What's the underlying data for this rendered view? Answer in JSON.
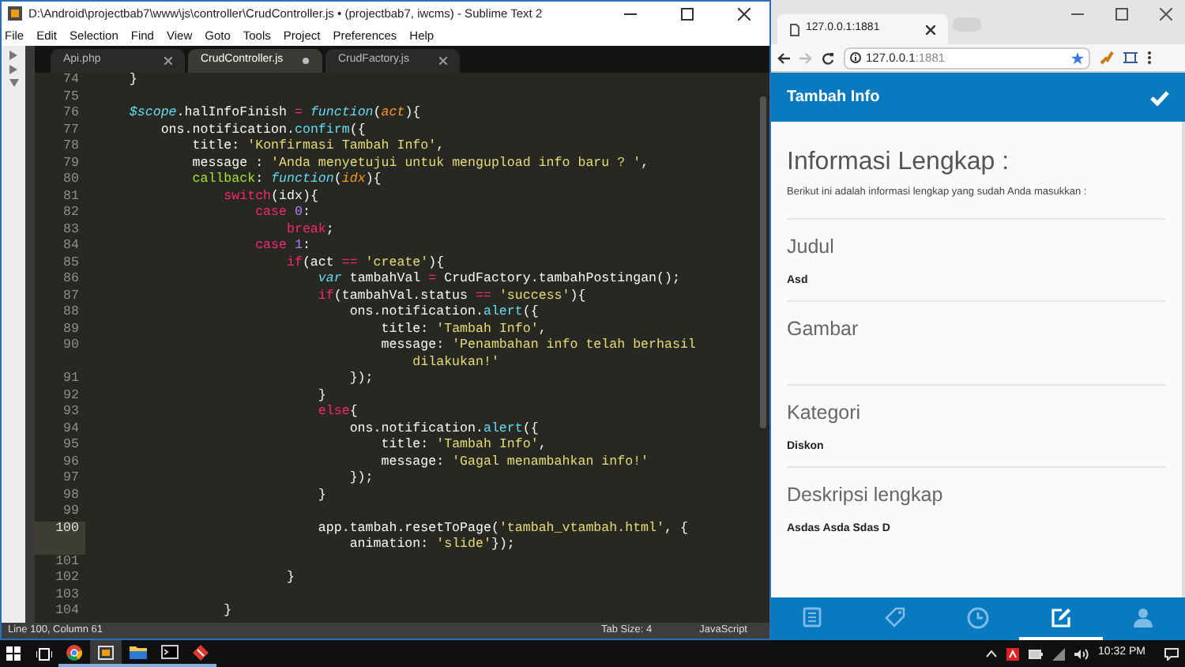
{
  "editor_window": {
    "title": "D:\\Android\\projectbab7\\www\\js\\controller\\CrudController.js • (projectbab7, iwcms) - Sublime Text 2",
    "menu": [
      "File",
      "Edit",
      "Selection",
      "Find",
      "View",
      "Goto",
      "Tools",
      "Project",
      "Preferences",
      "Help"
    ],
    "tabs": [
      {
        "label": "Api.php",
        "selected": false,
        "modified": false
      },
      {
        "label": "CrudController.js",
        "selected": true,
        "modified": true
      },
      {
        "label": "CrudFactory.js",
        "selected": false,
        "modified": false
      }
    ],
    "code_lines": [
      {
        "number": "74",
        "current": false,
        "rows": [
          {
            "segments": [
              {
                "text": "    }",
                "kind": "plain"
              }
            ]
          }
        ]
      },
      {
        "number": "75",
        "current": false,
        "rows": [
          {
            "segments": []
          }
        ]
      },
      {
        "number": "76",
        "current": false,
        "rows": [
          {
            "segments": [
              {
                "text": "    $scope",
                "kind": "storage"
              },
              {
                "text": ".halInfoFinish ",
                "kind": "plain"
              },
              {
                "text": "=",
                "kind": "keyword"
              },
              {
                "text": " function",
                "kind": "storage"
              },
              {
                "text": "(",
                "kind": "plain"
              },
              {
                "text": "act",
                "kind": "param"
              },
              {
                "text": "){",
                "kind": "plain"
              }
            ]
          }
        ]
      },
      {
        "number": "77",
        "current": false,
        "rows": [
          {
            "segments": [
              {
                "text": "        ons.notification.",
                "kind": "plain"
              },
              {
                "text": "confirm",
                "kind": "method"
              },
              {
                "text": "({",
                "kind": "plain"
              }
            ]
          }
        ]
      },
      {
        "number": "78",
        "current": false,
        "rows": [
          {
            "segments": [
              {
                "text": "            title: ",
                "kind": "plain"
              },
              {
                "text": "'Konfirmasi Tambah Info'",
                "kind": "string"
              },
              {
                "text": ",",
                "kind": "plain"
              }
            ]
          }
        ]
      },
      {
        "number": "79",
        "current": false,
        "rows": [
          {
            "segments": [
              {
                "text": "            message : ",
                "kind": "plain"
              },
              {
                "text": "'Anda menyetujui untuk mengupload info baru ? '",
                "kind": "string"
              },
              {
                "text": ",",
                "kind": "plain"
              }
            ]
          }
        ]
      },
      {
        "number": "80",
        "current": false,
        "rows": [
          {
            "segments": [
              {
                "text": "            callback",
                "kind": "entity"
              },
              {
                "text": ": ",
                "kind": "plain"
              },
              {
                "text": "function",
                "kind": "storage"
              },
              {
                "text": "(",
                "kind": "plain"
              },
              {
                "text": "idx",
                "kind": "param"
              },
              {
                "text": "){",
                "kind": "plain"
              }
            ]
          }
        ]
      },
      {
        "number": "81",
        "current": false,
        "rows": [
          {
            "segments": [
              {
                "text": "                switch",
                "kind": "keyword"
              },
              {
                "text": "(idx){",
                "kind": "plain"
              }
            ]
          }
        ]
      },
      {
        "number": "82",
        "current": false,
        "rows": [
          {
            "segments": [
              {
                "text": "                    case",
                "kind": "keyword"
              },
              {
                "text": " 0",
                "kind": "number"
              },
              {
                "text": ":",
                "kind": "plain"
              }
            ]
          }
        ]
      },
      {
        "number": "83",
        "current": false,
        "rows": [
          {
            "segments": [
              {
                "text": "                        break",
                "kind": "keyword"
              },
              {
                "text": ";",
                "kind": "plain"
              }
            ]
          }
        ]
      },
      {
        "number": "84",
        "current": false,
        "rows": [
          {
            "segments": [
              {
                "text": "                    case",
                "kind": "keyword"
              },
              {
                "text": " 1",
                "kind": "number"
              },
              {
                "text": ":",
                "kind": "plain"
              }
            ]
          }
        ]
      },
      {
        "number": "85",
        "current": false,
        "rows": [
          {
            "segments": [
              {
                "text": "                        if",
                "kind": "keyword"
              },
              {
                "text": "(act ",
                "kind": "plain"
              },
              {
                "text": "==",
                "kind": "keyword"
              },
              {
                "text": " 'create'",
                "kind": "string"
              },
              {
                "text": "){",
                "kind": "plain"
              }
            ]
          }
        ]
      },
      {
        "number": "86",
        "current": false,
        "rows": [
          {
            "segments": [
              {
                "text": "                            var",
                "kind": "storage"
              },
              {
                "text": " tambahVal ",
                "kind": "plain"
              },
              {
                "text": "=",
                "kind": "keyword"
              },
              {
                "text": " CrudFactory.tambahPostingan();",
                "kind": "plain"
              }
            ]
          }
        ]
      },
      {
        "number": "87",
        "current": false,
        "rows": [
          {
            "segments": [
              {
                "text": "                            if",
                "kind": "keyword"
              },
              {
                "text": "(tambahVal.status ",
                "kind": "plain"
              },
              {
                "text": "==",
                "kind": "keyword"
              },
              {
                "text": " 'success'",
                "kind": "string"
              },
              {
                "text": "){",
                "kind": "plain"
              }
            ]
          }
        ]
      },
      {
        "number": "88",
        "current": false,
        "rows": [
          {
            "segments": [
              {
                "text": "                                ons.notification.",
                "kind": "plain"
              },
              {
                "text": "alert",
                "kind": "method"
              },
              {
                "text": "({",
                "kind": "plain"
              }
            ]
          }
        ]
      },
      {
        "number": "89",
        "current": false,
        "rows": [
          {
            "segments": [
              {
                "text": "                                    title: ",
                "kind": "plain"
              },
              {
                "text": "'Tambah Info'",
                "kind": "string"
              },
              {
                "text": ",",
                "kind": "plain"
              }
            ]
          }
        ]
      },
      {
        "number": "90",
        "current": false,
        "rows": [
          {
            "segments": [
              {
                "text": "                                    message: ",
                "kind": "plain"
              },
              {
                "text": "'Penambahan info telah berhasil",
                "kind": "string"
              }
            ]
          },
          {
            "segments": [
              {
                "text": "                                        dilakukan!'",
                "kind": "string"
              }
            ]
          }
        ]
      },
      {
        "number": "91",
        "current": false,
        "rows": [
          {
            "segments": [
              {
                "text": "                                });",
                "kind": "plain"
              }
            ]
          }
        ]
      },
      {
        "number": "92",
        "current": false,
        "rows": [
          {
            "segments": [
              {
                "text": "                            }",
                "kind": "plain"
              }
            ]
          }
        ]
      },
      {
        "number": "93",
        "current": false,
        "rows": [
          {
            "segments": [
              {
                "text": "                            else",
                "kind": "keyword"
              },
              {
                "text": "{",
                "kind": "plain"
              }
            ]
          }
        ]
      },
      {
        "number": "94",
        "current": false,
        "rows": [
          {
            "segments": [
              {
                "text": "                                ons.notification.",
                "kind": "plain"
              },
              {
                "text": "alert",
                "kind": "method"
              },
              {
                "text": "({",
                "kind": "plain"
              }
            ]
          }
        ]
      },
      {
        "number": "95",
        "current": false,
        "rows": [
          {
            "segments": [
              {
                "text": "                                    title: ",
                "kind": "plain"
              },
              {
                "text": "'Tambah Info'",
                "kind": "string"
              },
              {
                "text": ",",
                "kind": "plain"
              }
            ]
          }
        ]
      },
      {
        "number": "96",
        "current": false,
        "rows": [
          {
            "segments": [
              {
                "text": "                                    message: ",
                "kind": "plain"
              },
              {
                "text": "'Gagal menambahkan info!'",
                "kind": "string"
              }
            ]
          }
        ]
      },
      {
        "number": "97",
        "current": false,
        "rows": [
          {
            "segments": [
              {
                "text": "                                });",
                "kind": "plain"
              }
            ]
          }
        ]
      },
      {
        "number": "98",
        "current": false,
        "rows": [
          {
            "segments": [
              {
                "text": "                            }",
                "kind": "plain"
              }
            ]
          }
        ]
      },
      {
        "number": "99",
        "current": false,
        "rows": [
          {
            "segments": []
          }
        ]
      },
      {
        "number": "100",
        "current": true,
        "rows": [
          {
            "segments": [
              {
                "text": "                            app.tambah.resetToPage(",
                "kind": "plain"
              },
              {
                "text": "'tambah_vtambah.html'",
                "kind": "string"
              },
              {
                "text": ", {",
                "kind": "plain"
              }
            ]
          },
          {
            "segments": [
              {
                "text": "                                animation: ",
                "kind": "plain"
              },
              {
                "text": "'slide'",
                "kind": "string"
              },
              {
                "text": "});",
                "kind": "plain"
              }
            ]
          }
        ]
      },
      {
        "number": "101",
        "current": false,
        "rows": [
          {
            "segments": []
          }
        ]
      },
      {
        "number": "102",
        "current": false,
        "rows": [
          {
            "segments": [
              {
                "text": "                        }",
                "kind": "plain"
              }
            ]
          }
        ]
      },
      {
        "number": "103",
        "current": false,
        "rows": [
          {
            "segments": []
          }
        ]
      },
      {
        "number": "104",
        "current": false,
        "rows": [
          {
            "segments": [
              {
                "text": "                }",
                "kind": "plain"
              }
            ]
          }
        ]
      }
    ],
    "status_bar": {
      "position": "Line 100, Column 61",
      "tab_size": "Tab Size: 4",
      "syntax": "JavaScript"
    }
  },
  "browser": {
    "tab_title": "127.0.0.1:1881",
    "url_host": "127.0.0.1",
    "url_port": ":1881",
    "app": {
      "header_title": "Tambah Info",
      "heading": "Informasi Lengkap :",
      "subtitle": "Berikut ini adalah informasi lengkap yang sudah Anda masukkan :",
      "sections": [
        {
          "label": "Judul",
          "value": "Asd"
        },
        {
          "label": "Gambar"
        },
        {
          "label": "Kategori",
          "value": "Diskon"
        },
        {
          "label": "Deskripsi lengkap",
          "value": "Asdas Asda Sdas D"
        }
      ],
      "bottom_tabs": [
        {
          "kind": "book",
          "selected": false
        },
        {
          "kind": "tag",
          "selected": false
        },
        {
          "kind": "clock",
          "selected": false
        },
        {
          "kind": "edit",
          "selected": true
        },
        {
          "kind": "person",
          "selected": false
        }
      ]
    }
  },
  "taskbar": {
    "apps": [
      {
        "kind": "chrome",
        "selected": false
      },
      {
        "kind": "sublime",
        "selected": true
      },
      {
        "kind": "folder",
        "selected": false
      },
      {
        "kind": "terminal",
        "selected": false
      },
      {
        "kind": "git",
        "selected": false
      }
    ],
    "time": "10:32 PM"
  }
}
